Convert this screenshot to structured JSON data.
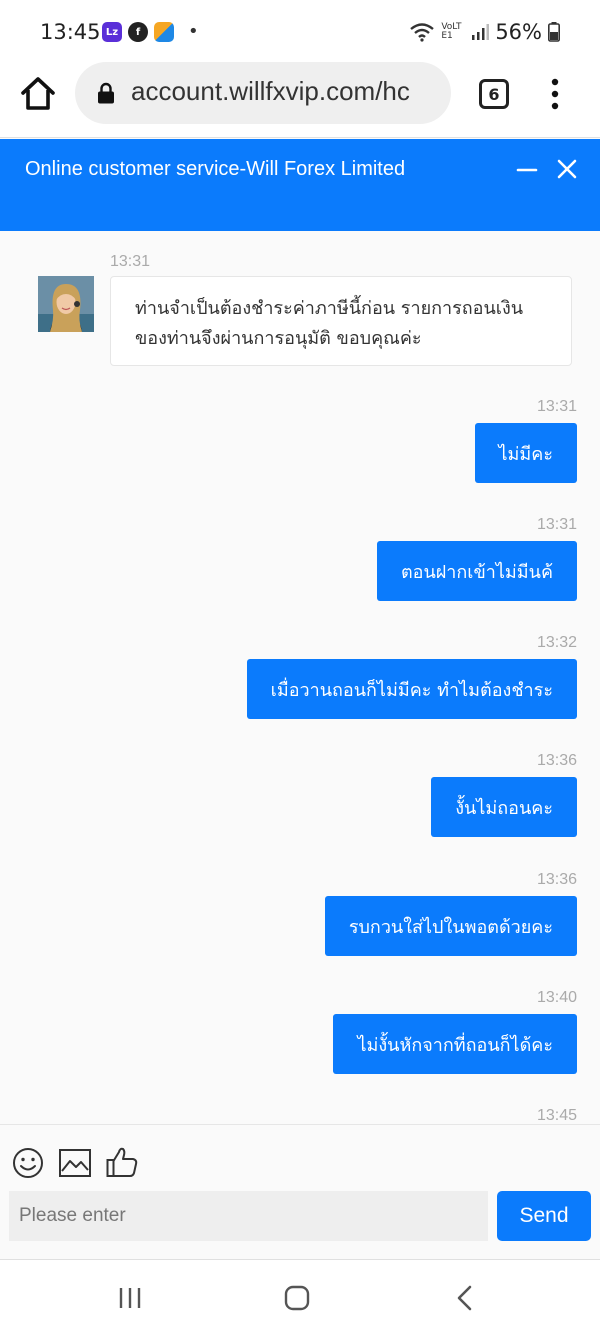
{
  "status_bar": {
    "time": "13:45",
    "battery": "56%",
    "network": "VoLTE1",
    "apps": [
      {
        "icon": "lazada-icon",
        "color": "#5a2fd8"
      },
      {
        "icon": "facebook-icon",
        "color": "#222222"
      },
      {
        "icon": "app-icon",
        "color": "#f5a623"
      }
    ]
  },
  "browser": {
    "url": "account.willfxvip.com/hc",
    "tab_count": "6"
  },
  "chat": {
    "title": "Online customer service-Will Forex Limited",
    "accent_color": "#0b7bfc",
    "messages": [
      {
        "direction": "in",
        "time": "13:31",
        "text": "ท่านจำเป็นต้องชำระค่าภาษีนี้ก่อน รายการถอนเงินของท่านจึงผ่านการอนุมัติ ขอบคุณค่ะ"
      },
      {
        "direction": "out",
        "time": "13:31",
        "text": "ไม่มีคะ"
      },
      {
        "direction": "out",
        "time": "13:31",
        "text": "ตอนฝากเข้าไม่มีนค้"
      },
      {
        "direction": "out",
        "time": "13:32",
        "text": "เมื่อวานถอนก็ไม่มีคะ ทำไมต้องชำระ"
      },
      {
        "direction": "out",
        "time": "13:36",
        "text": "งั้นไม่ถอนคะ"
      },
      {
        "direction": "out",
        "time": "13:36",
        "text": "รบกวนใส่ไปในพอตด้วยคะ"
      },
      {
        "direction": "out",
        "time": "13:40",
        "text": "ไม่งั้นหักจากที่ถอนก็ได้คะ"
      },
      {
        "direction": "out",
        "time": "13:45",
        "text": ""
      }
    ]
  },
  "composer": {
    "placeholder": "Please enter",
    "send_label": "Send"
  }
}
